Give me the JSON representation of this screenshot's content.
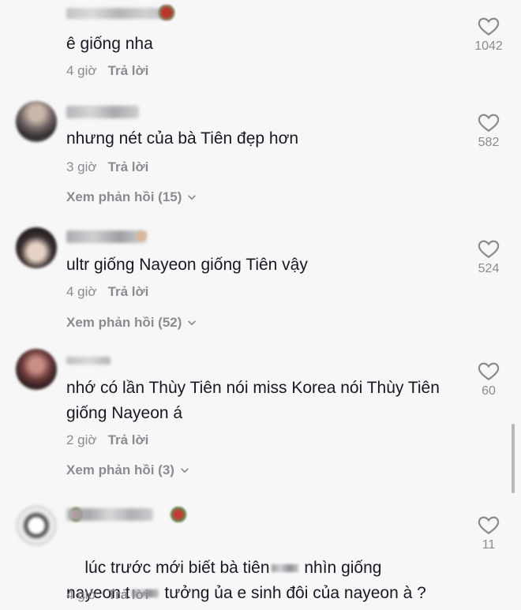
{
  "comments": [
    {
      "text": "ê giống nha",
      "time": "4 giờ",
      "reply_label": "Trả lời",
      "likes": "1042",
      "view_replies": ""
    },
    {
      "text": "nhưng nét của bà Tiên đẹp hơn",
      "time": "3 giờ",
      "reply_label": "Trả lời",
      "likes": "582",
      "view_replies": "Xem phản hồi (15)"
    },
    {
      "text": "ultr giống Nayeon giống Tiên vậy",
      "time": "4 giờ",
      "reply_label": "Trả lời",
      "likes": "524",
      "view_replies": "Xem phản hồi (52)"
    },
    {
      "text": "nhớ có lần Thùy Tiên nói miss Korea nói Thùy Tiên giống Nayeon á",
      "time": "2 giờ",
      "reply_label": "Trả lời",
      "likes": "60",
      "view_replies": "Xem phản hồi (3)"
    },
    {
      "text_part1": "lúc trước mới biết bà tiên",
      "text_part2": " nhìn giống",
      "text_line2_a": "nayeon t",
      "text_line2_b": " tưởng ủa e sinh đôi của nayeon à ?",
      "time": "4 giờ",
      "reply_label": "Trả lời",
      "likes": "11"
    }
  ],
  "icons": {
    "like": "heart-outline-icon",
    "expand": "chevron-down-icon"
  },
  "colors": {
    "background": "#f7f7f7",
    "text": "#161823",
    "secondary": "#8a8b91"
  }
}
